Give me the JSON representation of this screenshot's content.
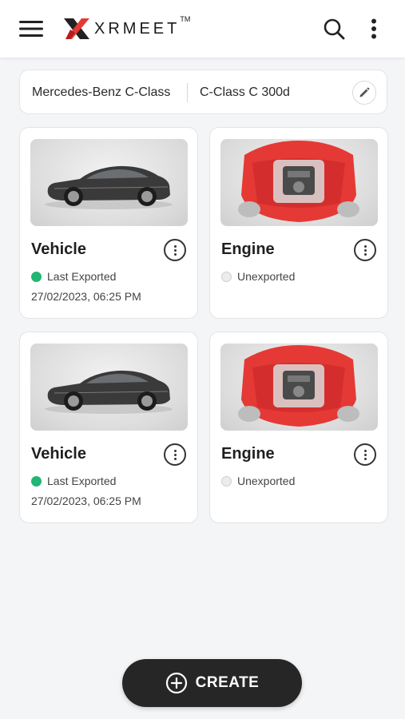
{
  "app": {
    "name": "XRMEET",
    "trademark": "TM",
    "brand_color": "#e53935"
  },
  "header": {
    "menu_icon": "hamburger-icon",
    "search_icon": "search-icon",
    "more_icon": "kebab-vertical-icon"
  },
  "model": {
    "make": "Mercedes-Benz C-Class",
    "variant": "C-Class C 300d",
    "edit_icon": "pencil-icon"
  },
  "cards": [
    {
      "title": "Vehicle",
      "status": "Last Exported",
      "status_color": "#22b573",
      "date": "27/02/2023, 06:25 PM",
      "image": "car-side-image"
    },
    {
      "title": "Engine",
      "status": "Unexported",
      "status_color": "#ececec",
      "date": "",
      "image": "engine-cutaway-image"
    },
    {
      "title": "Vehicle",
      "status": "Last Exported",
      "status_color": "#22b573",
      "date": "27/02/2023, 06:25 PM",
      "image": "car-side-image"
    },
    {
      "title": "Engine",
      "status": "Unexported",
      "status_color": "#ececec",
      "date": "",
      "image": "engine-cutaway-image"
    }
  ],
  "create": {
    "label": "CREATE",
    "icon": "plus-circle-icon"
  }
}
